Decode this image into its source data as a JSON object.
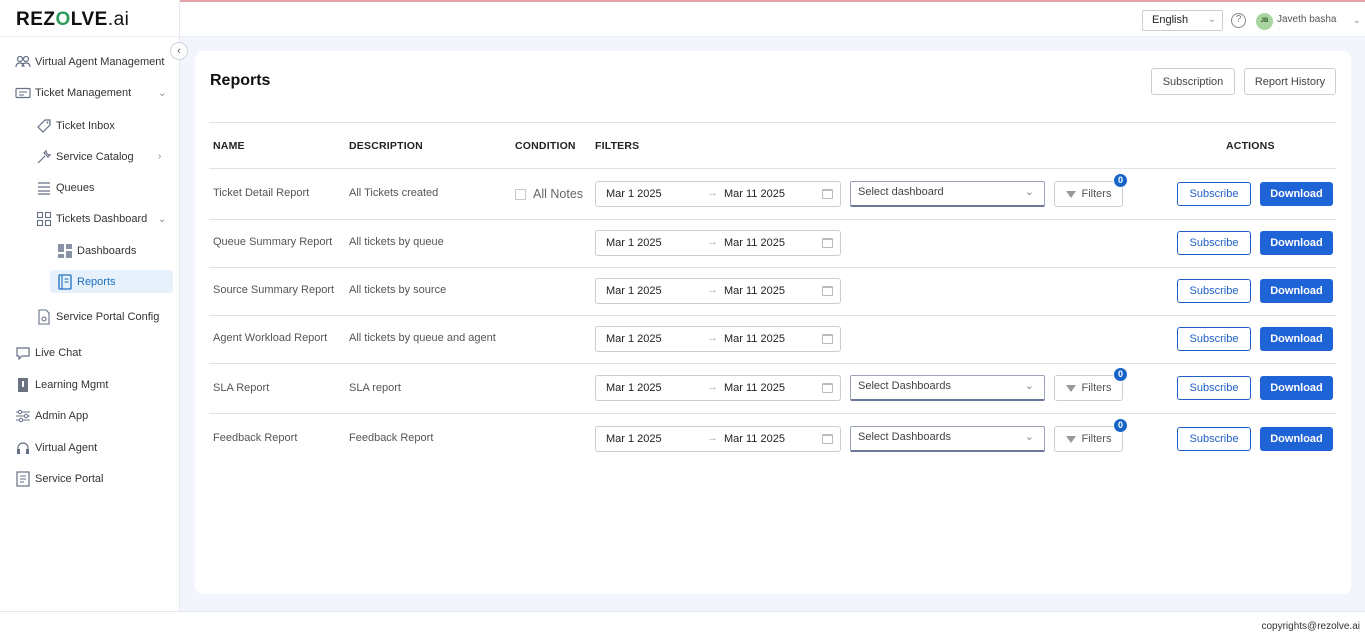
{
  "brand": {
    "logo_main": "REZ",
    "logo_o": "O",
    "logo_rest": "LVE",
    "logo_suffix": ".ai"
  },
  "sidebar": {
    "items": [
      {
        "label": "Virtual Agent Management",
        "icon": "users-icon"
      },
      {
        "label": "Ticket Management",
        "icon": "ticket-icon"
      },
      {
        "label": "Ticket Inbox",
        "icon": "tag-icon"
      },
      {
        "label": "Service Catalog",
        "icon": "wrench-icon"
      },
      {
        "label": "Queues",
        "icon": "list-icon"
      },
      {
        "label": "Tickets Dashboard",
        "icon": "grid-icon"
      },
      {
        "label": "Dashboards",
        "icon": "dashboard-icon"
      },
      {
        "label": "Reports",
        "icon": "report-icon"
      },
      {
        "label": "Service Portal Config",
        "icon": "file-settings-icon"
      },
      {
        "label": "Live Chat",
        "icon": "chat-icon"
      },
      {
        "label": "Learning Mgmt",
        "icon": "book-icon"
      },
      {
        "label": "Admin App",
        "icon": "sliders-icon"
      },
      {
        "label": "Virtual Agent",
        "icon": "headset-icon"
      },
      {
        "label": "Service Portal",
        "icon": "document-icon"
      }
    ]
  },
  "topbar": {
    "language": "English",
    "help": "?",
    "user_initials": "JB",
    "user_name": "Javeth basha"
  },
  "page": {
    "title": "Reports",
    "subscription_label": "Subscription",
    "report_history_label": "Report History"
  },
  "table": {
    "headers": {
      "name": "NAME",
      "description": "DESCRIPTION",
      "condition": "CONDITION",
      "filters": "FILTERS",
      "actions": "ACTIONS"
    },
    "rows": [
      {
        "name": "Ticket Detail Report",
        "description": "All Tickets created",
        "condition": "All Notes",
        "date_from": "Mar 1 2025",
        "date_to": "Mar 11 2025",
        "select": "Select dashboard",
        "filters_label": "Filters",
        "filter_count": "0",
        "subscribe": "Subscribe",
        "download": "Download"
      },
      {
        "name": "Queue Summary Report",
        "description": "All tickets by queue",
        "date_from": "Mar 1 2025",
        "date_to": "Mar 11 2025",
        "subscribe": "Subscribe",
        "download": "Download"
      },
      {
        "name": "Source Summary Report",
        "description": "All tickets by source",
        "date_from": "Mar 1 2025",
        "date_to": "Mar 11 2025",
        "subscribe": "Subscribe",
        "download": "Download"
      },
      {
        "name": "Agent Workload Report",
        "description": "All tickets by queue and agent",
        "date_from": "Mar 1 2025",
        "date_to": "Mar 11 2025",
        "subscribe": "Subscribe",
        "download": "Download"
      },
      {
        "name": "SLA Report",
        "description": "SLA report",
        "date_from": "Mar 1 2025",
        "date_to": "Mar 11 2025",
        "select": "Select Dashboards",
        "filters_label": "Filters",
        "filter_count": "0",
        "subscribe": "Subscribe",
        "download": "Download"
      },
      {
        "name": "Feedback Report",
        "description": "Feedback Report",
        "date_from": "Mar 1 2025",
        "date_to": "Mar 11 2025",
        "select": "Select Dashboards",
        "filters_label": "Filters",
        "filter_count": "0",
        "subscribe": "Subscribe",
        "download": "Download"
      }
    ]
  },
  "footer": {
    "copyright": "copyrights@rezolve.ai"
  },
  "colors": {
    "primary": "#1f64d6",
    "active_bg": "#e6f1fb",
    "page_bg": "#f2f5fb"
  }
}
